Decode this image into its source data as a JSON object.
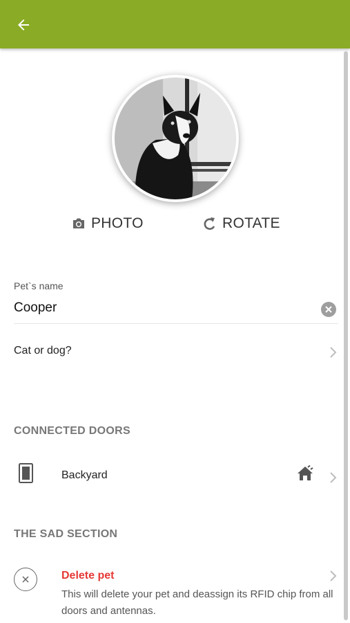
{
  "profile": {
    "photo_label": "PHOTO",
    "rotate_label": "ROTATE"
  },
  "name_field": {
    "label": "Pet`s name",
    "value": "Cooper"
  },
  "species_row": {
    "label": "Cat or dog?"
  },
  "connected_doors": {
    "header": "CONNECTED DOORS",
    "items": [
      {
        "name": "Backyard",
        "status_icon": "home-icon"
      }
    ]
  },
  "sad_section": {
    "header": "THE SAD SECTION",
    "delete_title": "Delete pet",
    "delete_description": "This will delete your pet and deassign its RFID chip from all doors and antennas."
  },
  "colors": {
    "appbar": "#8aab25",
    "danger": "#e53935",
    "section_header": "#777777"
  }
}
